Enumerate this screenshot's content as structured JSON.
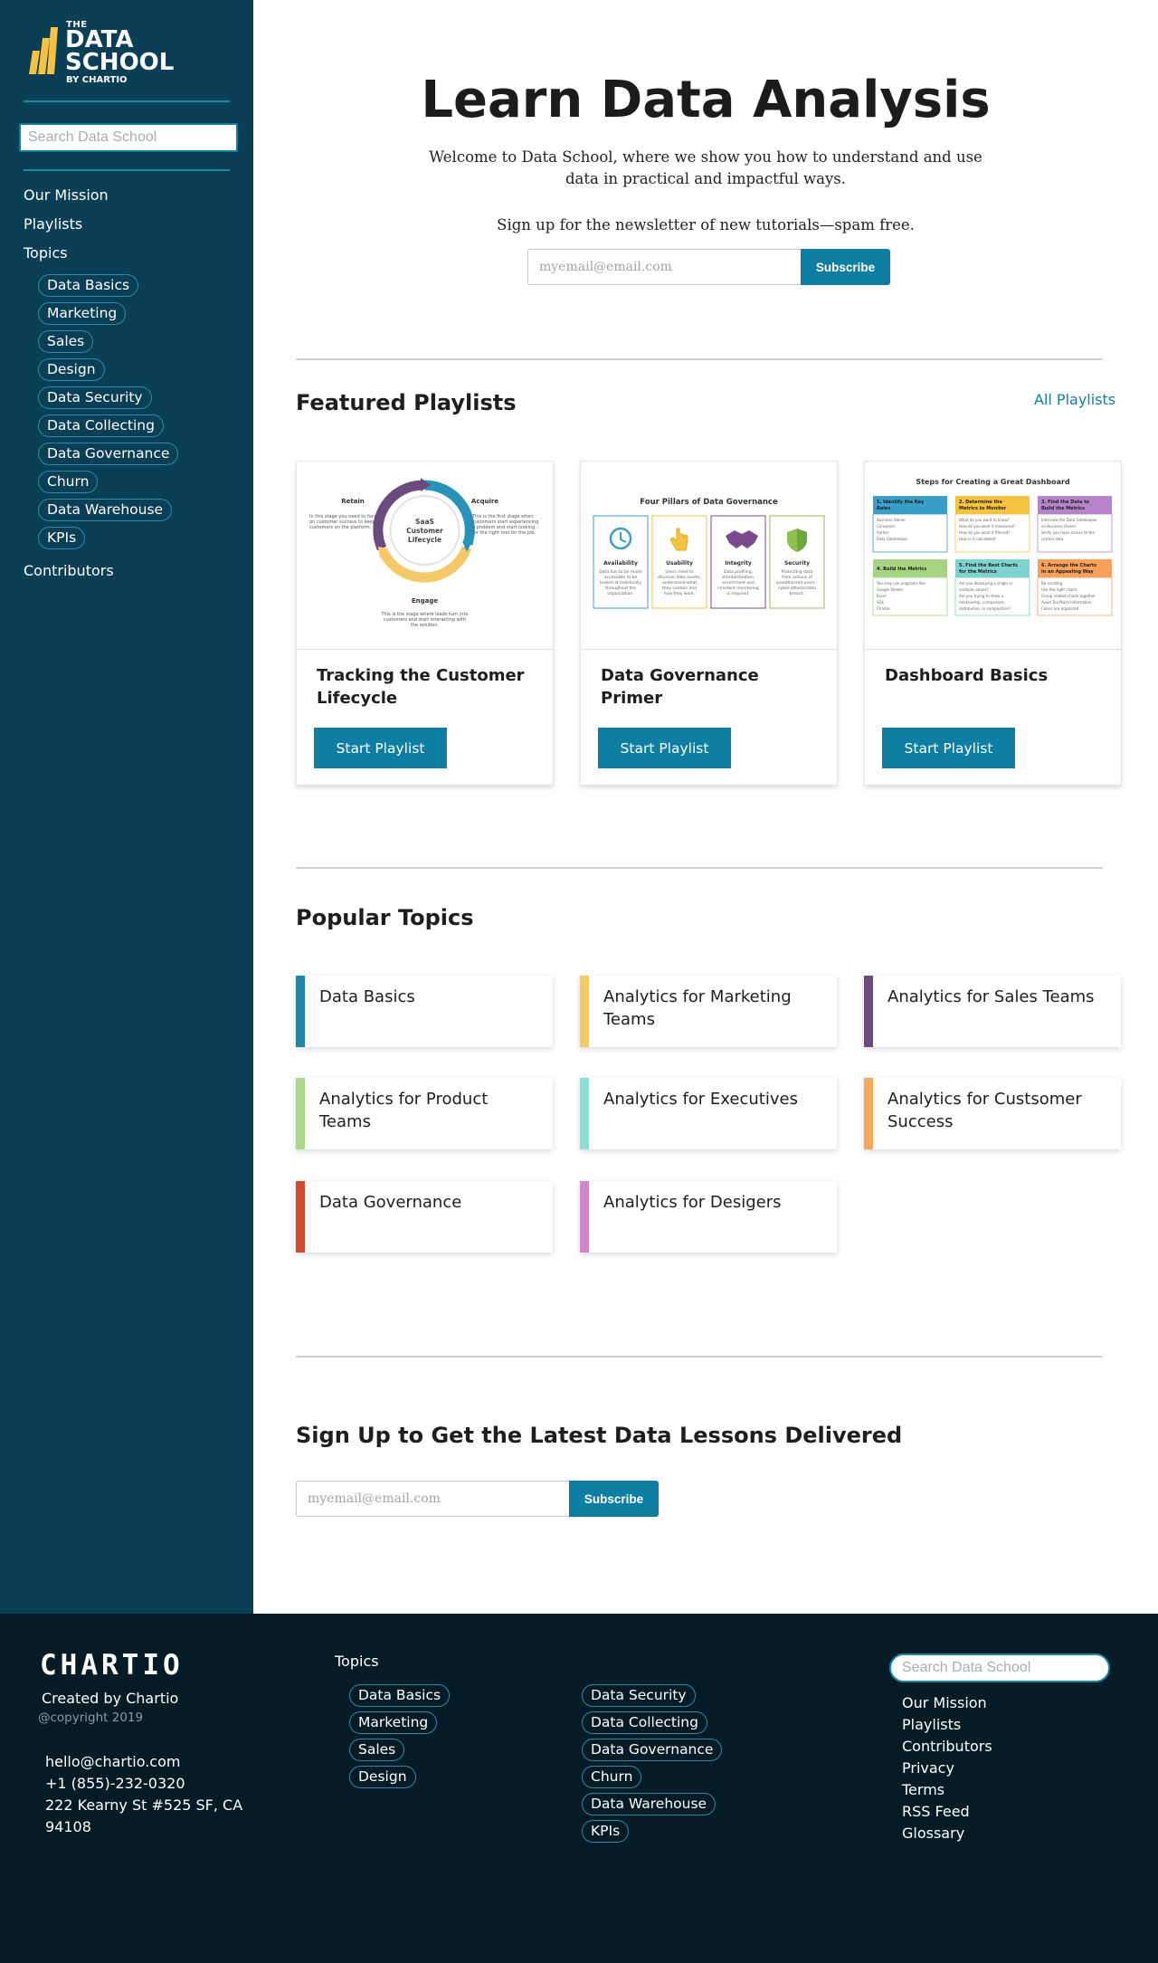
{
  "brand": {
    "logo_the": "THE",
    "logo_data": "DATA",
    "logo_school": "SCHOOL",
    "logo_by": "BY CHARTIO",
    "accent_yellow": "#f5c342",
    "primary": "#0f7ea3",
    "sidebar_bg": "#0b3f55",
    "footer_bg": "#051c27"
  },
  "sidebar": {
    "search_placeholder": "Search Data School",
    "nav": {
      "mission": "Our Mission",
      "playlists": "Playlists",
      "topics": "Topics",
      "contributors": "Contributors"
    },
    "topics": [
      "Data Basics",
      "Marketing",
      "Sales",
      "Design",
      "Data Security",
      "Data Collecting",
      "Data Governance",
      "Churn",
      "Data Warehouse",
      "KPIs"
    ]
  },
  "hero": {
    "title": "Learn Data Analysis",
    "subtitle": "Welcome to Data School, where we show you how to understand and use data in practical and impactful ways.",
    "newsletter_text": "Sign up for the newsletter of new tutorials—spam free.",
    "email_placeholder": "myemail@email.com",
    "subscribe_label": "Subscribe"
  },
  "featured": {
    "title": "Featured Playlists",
    "all_link": "All Playlists",
    "button_label": "Start Playlist",
    "cards": [
      {
        "title": "Tracking the Customer Lifecycle",
        "thumb": {
          "center": [
            "SaaS",
            "Customer",
            "Lifecycle"
          ],
          "retain": "Retain",
          "acquire": "Acquire",
          "engage": "Engage",
          "retain_text": [
            "In this stage you need to focus",
            "on customer success to keep",
            "customers on the platform."
          ],
          "acquire_text": [
            "This is the first stage when",
            "customers start experiencing",
            "a problem and start looking",
            "for the right tool for the job."
          ],
          "engage_text": [
            "This is the stage where leads turn into",
            "customers and start interacting with",
            "the solution."
          ]
        }
      },
      {
        "title": "Data Governance Primer",
        "thumb": {
          "heading": "Four Pillars of Data Governance",
          "pillars": [
            {
              "name": "Availability",
              "text": [
                "Data has to be made",
                "accessible to be",
                "looked at holistically",
                "throughout the",
                "organization."
              ],
              "color": "#3b9ec9",
              "icon": "clock-icon"
            },
            {
              "name": "Usability",
              "text": [
                "Users need to",
                "discover data assets,",
                "understand what",
                "they contain and",
                "how they work."
              ],
              "color": "#f5c342",
              "icon": "hand-pointer-icon"
            },
            {
              "name": "Integrity",
              "text": [
                "Data profiling,",
                "standardization,",
                "enrichment and",
                "constant monitoring",
                "is required."
              ],
              "color": "#7a4b8c",
              "icon": "handshake-icon"
            },
            {
              "name": "Security",
              "text": [
                "Protecting data",
                "from actions of",
                "unauthorized users –",
                "cyber-attacks/data",
                "breach."
              ],
              "color": "#8cc152",
              "icon": "shield-icon"
            }
          ]
        }
      },
      {
        "title": "Dashboard Basics",
        "thumb": {
          "heading": "Steps for Creating a Great Dashboard",
          "steps": [
            {
              "label": [
                "1. Identify the Key",
                "Roles"
              ],
              "color": "#3b9ec9",
              "items": [
                "Business Owner",
                "Consumer",
                "Author",
                "Data Gatekeeper"
              ]
            },
            {
              "label": [
                "2. Determine the",
                "Metrics to Monitor"
              ],
              "color": "#f5c342",
              "items": [
                "What do you want to know?",
                "How do you want it measured?",
                "How do you want it filtered?",
                "How is it calculated?"
              ]
            },
            {
              "label": [
                "3. Find the Data to",
                "Build the Metrics"
              ],
              "color": "#b784c9",
              "items": [
                "Interview the Data Gatekeeper",
                "on Business Owner",
                "Verify you have access to the",
                "correct data"
              ]
            },
            {
              "label": [
                "4. Build the Metrics"
              ],
              "color": "#a6d482",
              "items": [
                "You may use programs like",
                "Google Sheets",
                "Excel",
                "SQL",
                "Chartio"
              ]
            },
            {
              "label": [
                "5. Find the Best Charts",
                "for the Metrics"
              ],
              "color": "#7dd3d0",
              "items": [
                "Are you displaying a single or",
                "multiple values?",
                "Are you trying to show a",
                "relationship, comparison,",
                "distribution, or composition?"
              ]
            },
            {
              "label": [
                "6. Arrange the Charts",
                "in an Appealing Way"
              ],
              "color": "#f9a05a",
              "items": [
                "Be scrolling",
                "Use the right charts",
                "Group related charts together",
                "Avoid Too Much Information",
                "Colors are organized"
              ]
            }
          ]
        }
      }
    ]
  },
  "popular": {
    "title": "Popular Topics",
    "items": [
      {
        "label": "Data Basics",
        "color": "#1d87a9"
      },
      {
        "label": "Analytics for Marketing Teams",
        "color": "#f5c96a"
      },
      {
        "label": "Analytics for Sales Teams",
        "color": "#6b4a7d"
      },
      {
        "label": "Analytics for Product Teams",
        "color": "#a8d88a"
      },
      {
        "label": "Analytics for Executives",
        "color": "#8dddd0"
      },
      {
        "label": "Analytics for Custsomer Success",
        "color": "#f7a85a"
      },
      {
        "label": "Data Governance",
        "color": "#d24a32"
      },
      {
        "label": "Analytics for Desigers",
        "color": "#d584c9"
      }
    ]
  },
  "signup": {
    "title": "Sign Up to Get the Latest Data Lessons Delivered",
    "email_placeholder": "myemail@email.com",
    "subscribe_label": "Subscribe"
  },
  "footer": {
    "logo": "CHARTIO",
    "created": "Created by Chartio",
    "copyright": "@copyright 2019",
    "email": "hello@chartio.com",
    "phone": "+1 (855)-232-0320",
    "address": "222 Kearny St #525 SF, CA 94108",
    "topics_label": "Topics",
    "topics_col1": [
      "Data Basics",
      "Marketing",
      "Sales",
      "Design"
    ],
    "topics_col2": [
      "Data Security",
      "Data Collecting",
      "Data Governance",
      "Churn",
      "Data Warehouse",
      "KPIs"
    ],
    "search_placeholder": "Search Data School",
    "links": [
      "Our Mission",
      "Playlists",
      "Contributors",
      "Privacy",
      "Terms",
      "RSS Feed",
      "Glossary"
    ]
  }
}
